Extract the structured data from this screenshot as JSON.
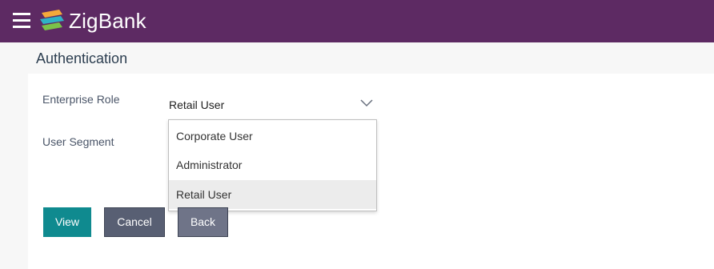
{
  "header": {
    "brand": "ZigBank",
    "bg_color": "#5d2a63",
    "menu_icon": "hamburger-icon",
    "logo_icon": "zigbank-logo-icon"
  },
  "page": {
    "title": "Authentication"
  },
  "form": {
    "enterprise_role_label": "Enterprise Role",
    "enterprise_role_value": "Retail User",
    "user_segment_label": "User Segment",
    "dropdown_icon": "chevron-down-icon",
    "options": [
      "Corporate User",
      "Administrator",
      "Retail User"
    ],
    "selected_option": "Retail User"
  },
  "buttons": {
    "view": "View",
    "cancel": "Cancel",
    "back": "Back",
    "primary_color": "#0f8a8f",
    "secondary_color": "#585f73"
  }
}
